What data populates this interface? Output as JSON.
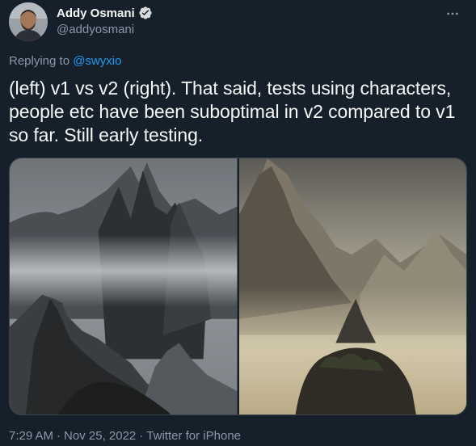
{
  "author": {
    "name": "Addy Osmani",
    "handle": "@addyosmani"
  },
  "reply": {
    "prefix": "Replying to ",
    "mention": "@swyxio"
  },
  "tweet": {
    "text": "(left) v1 vs v2 (right). That said, tests using characters, people etc have been suboptimal in v2 compared to v1 so far. Still early testing."
  },
  "meta": {
    "time": "7:29 AM",
    "sep1": "·",
    "date": "Nov 25, 2022",
    "sep2": "·",
    "source": "Twitter for iPhone"
  },
  "colors": {
    "background": "#15202b",
    "text": "#f7f9f9",
    "secondary": "#8b98a5",
    "accent": "#1d9bf0"
  },
  "icons": {
    "verified": "verified-badge-icon",
    "more": "more-options-icon"
  }
}
